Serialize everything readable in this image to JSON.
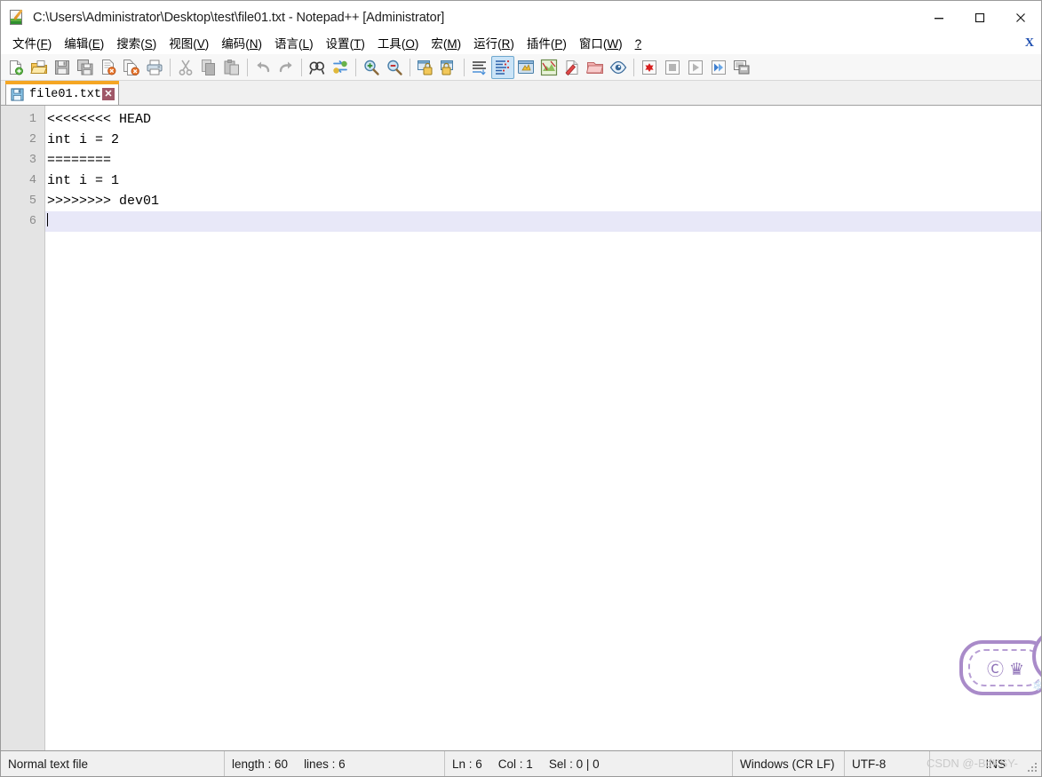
{
  "window": {
    "title": "C:\\Users\\Administrator\\Desktop\\test\\file01.txt - Notepad++ [Administrator]",
    "icon": "notepad-plus-plus-icon",
    "minimize_label": "—",
    "maximize_label": "□",
    "close_label": "✕"
  },
  "menubar": {
    "items": [
      {
        "label": "文件",
        "accel": "F"
      },
      {
        "label": "编辑",
        "accel": "E"
      },
      {
        "label": "搜索",
        "accel": "S"
      },
      {
        "label": "视图",
        "accel": "V"
      },
      {
        "label": "编码",
        "accel": "N"
      },
      {
        "label": "语言",
        "accel": "L"
      },
      {
        "label": "设置",
        "accel": "T"
      },
      {
        "label": "工具",
        "accel": "O"
      },
      {
        "label": "宏",
        "accel": "M"
      },
      {
        "label": "运行",
        "accel": "R"
      },
      {
        "label": "插件",
        "accel": "P"
      },
      {
        "label": "窗口",
        "accel": "W"
      },
      {
        "label": "?",
        "accel": ""
      }
    ],
    "close_document_label": "X"
  },
  "toolbar": {
    "buttons": [
      {
        "name": "new-file-icon",
        "title": "新建"
      },
      {
        "name": "open-file-icon",
        "title": "打开"
      },
      {
        "name": "save-icon",
        "title": "保存"
      },
      {
        "name": "save-all-icon",
        "title": "保存所有"
      },
      {
        "name": "close-file-icon",
        "title": "关闭"
      },
      {
        "name": "close-all-files-icon",
        "title": "关闭所有"
      },
      {
        "name": "print-icon",
        "title": "打印"
      },
      {
        "name": "separator"
      },
      {
        "name": "cut-icon",
        "title": "剪切",
        "disabled": true
      },
      {
        "name": "copy-icon",
        "title": "复制",
        "disabled": true
      },
      {
        "name": "paste-icon",
        "title": "粘贴",
        "disabled": true
      },
      {
        "name": "separator"
      },
      {
        "name": "undo-icon",
        "title": "撤销",
        "disabled": true
      },
      {
        "name": "redo-icon",
        "title": "重做",
        "disabled": true
      },
      {
        "name": "separator"
      },
      {
        "name": "find-icon",
        "title": "查找"
      },
      {
        "name": "replace-icon",
        "title": "替换"
      },
      {
        "name": "separator"
      },
      {
        "name": "zoom-in-icon",
        "title": "放大"
      },
      {
        "name": "zoom-out-icon",
        "title": "缩小"
      },
      {
        "name": "separator"
      },
      {
        "name": "sync-vertical-scroll-icon",
        "title": "同步垂直滚动"
      },
      {
        "name": "sync-horizontal-scroll-icon",
        "title": "同步水平滚动"
      },
      {
        "name": "separator"
      },
      {
        "name": "word-wrap-icon",
        "title": "自动换行"
      },
      {
        "name": "show-all-characters-icon",
        "title": "显示所有字符",
        "active": true
      },
      {
        "name": "show-indent-guide-icon",
        "title": "显示缩进参考线"
      },
      {
        "name": "user-defined-dialog-icon",
        "title": "用户自定义对话框"
      },
      {
        "name": "show-symbols-icon",
        "title": "显示符号"
      },
      {
        "name": "document-map-icon",
        "title": "文档地图"
      },
      {
        "name": "function-list-icon",
        "title": "函数列表"
      },
      {
        "name": "folder-as-workspace-icon",
        "title": "文件夹作为工作区"
      },
      {
        "name": "monitoring-icon",
        "title": "监视文件"
      },
      {
        "name": "separator"
      },
      {
        "name": "macro-record-icon",
        "title": "开始录制"
      },
      {
        "name": "macro-stop-icon",
        "title": "停止录制",
        "disabled": true
      },
      {
        "name": "macro-play-icon",
        "title": "播放",
        "disabled": true
      },
      {
        "name": "macro-playmultiple-icon",
        "title": "多次运行宏"
      },
      {
        "name": "macro-save-icon",
        "title": "保存当前录制的宏"
      }
    ]
  },
  "tabs": [
    {
      "label": "file01.txt",
      "active": true,
      "close_label": "✕",
      "icon": "saved-floppy-icon"
    }
  ],
  "editor": {
    "line_numbers": [
      "1",
      "2",
      "3",
      "4",
      "5",
      "6"
    ],
    "lines": [
      "<<<<<<<< HEAD",
      "int i = 2",
      "========",
      "int i = 1",
      ">>>>>>>> dev01",
      ""
    ],
    "current_line_index": 5,
    "current_line_color": "#e8e8f8"
  },
  "sticker": {
    "name": "purple-sticker-watermark",
    "glyphs": "Ⓒ ♛"
  },
  "statusbar": {
    "file_type": "Normal text file",
    "length_label": "length : 60",
    "lines_label": "lines : 6",
    "ln_label": "Ln : 6",
    "col_label": "Col : 1",
    "sel_label": "Sel : 0 | 0",
    "eol": "Windows (CR LF)",
    "encoding": "UTF-8",
    "insert_mode": "INS",
    "watermark": "CSDN @-BdKSY-"
  }
}
